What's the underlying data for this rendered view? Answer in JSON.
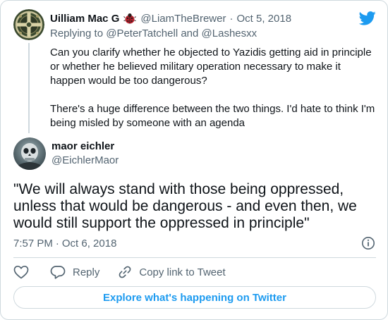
{
  "colors": {
    "accent": "#1d9bf0",
    "text": "#0f1419",
    "secondary": "#536471",
    "border": "#cfd9de"
  },
  "icons": {
    "logo": "twitter-bird-icon",
    "badge": "ladybug-icon",
    "info": "info-icon",
    "like": "heart-icon",
    "reply": "reply-bubble-icon",
    "copy": "link-icon"
  },
  "parent_tweet": {
    "author_name": "Uilliam Mac G",
    "handle": "@LiamTheBrewer",
    "separator": "·",
    "date": "Oct 5, 2018",
    "replying_prefix": "Replying to",
    "replying_user_1": "@PeterTatchell",
    "replying_and": "and",
    "replying_user_2": "@Lashesxx",
    "text_p1": "Can you clarify whether he objected to Yazidis getting aid in principle or whether he believed military operation necessary to make it happen would be too dangerous?",
    "text_p2": "There's a huge difference between the two things. I'd hate to think I'm being misled by someone with an agenda"
  },
  "main_tweet": {
    "author_name": "maor eichler",
    "handle": "@EichlerMaor",
    "text": "\"We will always stand with those being oppressed, unless that would be dangerous - and even then, we would still support the oppressed in principle\"",
    "time": "7:57 PM",
    "separator": "·",
    "date": "Oct 6, 2018"
  },
  "actions": {
    "reply_label": "Reply",
    "copy_label": "Copy link to Tweet"
  },
  "explore_label": "Explore what's happening on Twitter"
}
